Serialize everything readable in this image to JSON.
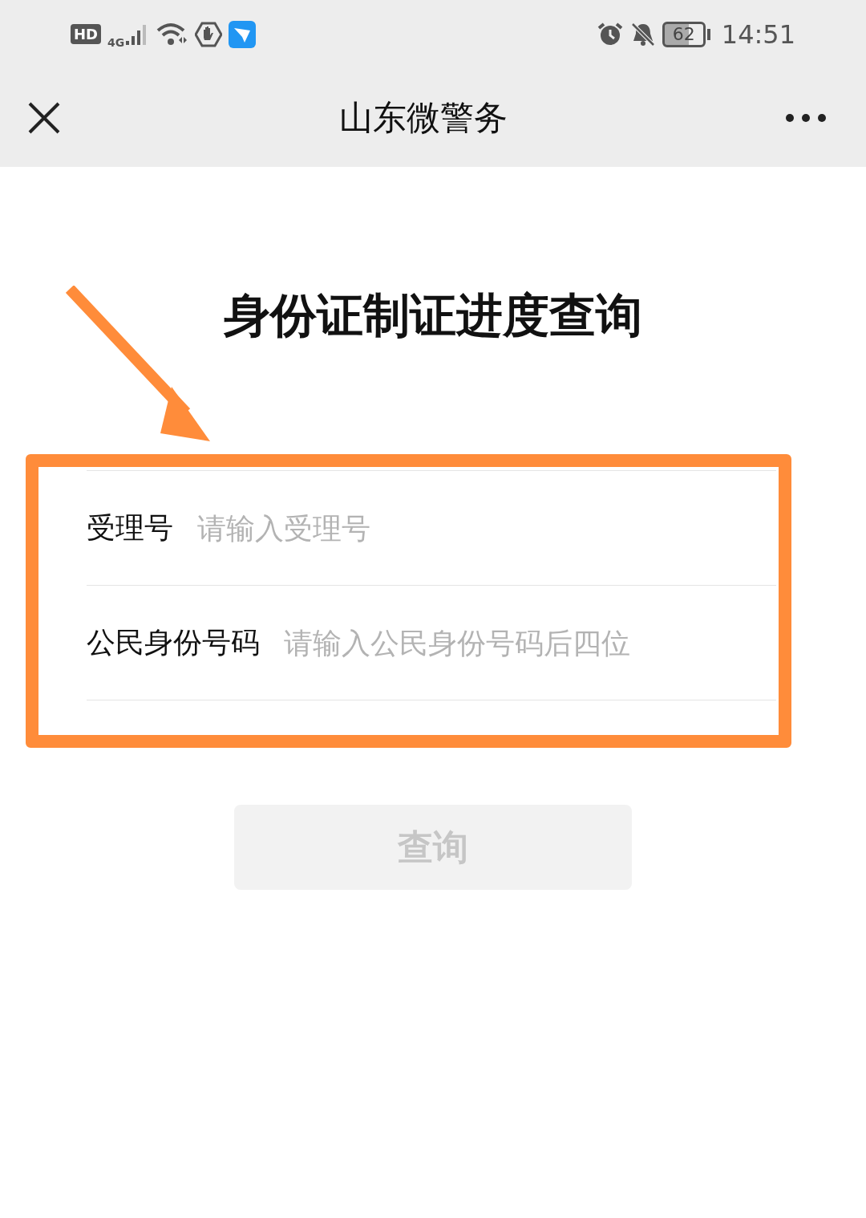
{
  "status_bar": {
    "network_badge": "HD",
    "network_type": "4G",
    "battery": "62",
    "time": "14:51"
  },
  "nav_bar": {
    "title": "山东微警务"
  },
  "heading": "身份证制证进度查询",
  "fields": [
    {
      "label": "受理号",
      "placeholder": "请输入受理号"
    },
    {
      "label": "公民身份号码",
      "placeholder": "请输入公民身份号码后四位"
    }
  ],
  "submit_button": {
    "label": "查询",
    "disabled": true
  }
}
